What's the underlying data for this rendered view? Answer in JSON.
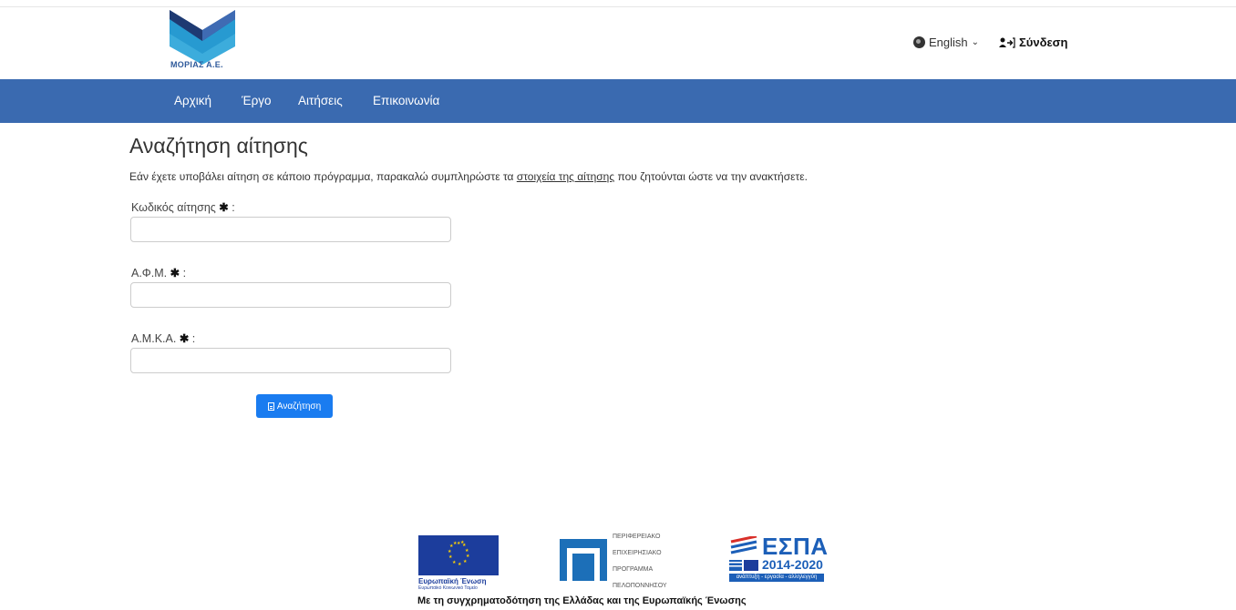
{
  "header": {
    "logo_text": "ΜΟΡΙΑΣ Α.Ε.",
    "language_label": "English",
    "login_label": "Σύνδεση"
  },
  "nav": {
    "items": [
      {
        "label": "Αρχική"
      },
      {
        "label": "Έργο"
      },
      {
        "label": "Αιτήσεις"
      },
      {
        "label": "Επικοινωνία"
      }
    ]
  },
  "main": {
    "title": "Αναζήτηση αίτησης",
    "intro_before": "Εάν έχετε υποβάλει αίτηση σε κάποιο πρόγραμμα, παρακαλώ συμπληρώστε τα ",
    "intro_link": "στοιχεία της αίτησης",
    "intro_after": " που ζητούνται ώστε να την ανακτήσετε.",
    "fields": [
      {
        "label": "Κωδικός αίτησης",
        "value": ""
      },
      {
        "label": "Α.Φ.Μ.",
        "value": ""
      },
      {
        "label": "Α.Μ.Κ.Α.",
        "value": ""
      }
    ],
    "search_button": "Αναζήτηση"
  },
  "footer": {
    "eu_name": "Ευρωπαϊκή Ένωση",
    "eu_fund": "Ευρωπαϊκό Κοινωνικό Ταμείο",
    "pep_lines": [
      "ΠΕΡΙΦΕΡΕΙΑΚΟ",
      "ΕΠΙΧΕΙΡΗΣΙΑΚΟ",
      "ΠΡΟΓΡΑΜΜΑ",
      "ΠΕΛΟΠΟΝΝΗΣΟΥ"
    ],
    "espa_title": "ΕΣΠΑ",
    "espa_years": "2014-2020",
    "espa_slogan": "ανάπτυξη - εργασία - αλληλεγγύη",
    "funding_text": "Με τη συγχρηματοδότηση της Ελλάδας και της Ευρωπαϊκής Ένωσης"
  },
  "colors": {
    "nav_bg": "#3a6ab0",
    "button_bg": "#1a7cf0",
    "eu_blue": "#1c3d9c",
    "espa_blue": "#1c5fb8"
  }
}
